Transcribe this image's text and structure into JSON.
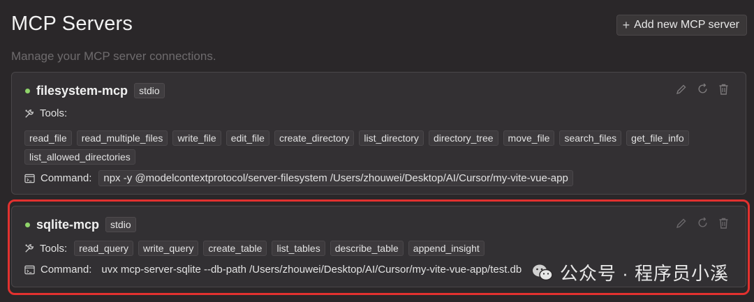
{
  "header": {
    "title": "MCP Servers",
    "subtitle": "Manage your MCP server connections.",
    "add_button": "Add new MCP server"
  },
  "servers": [
    {
      "name": "filesystem-mcp",
      "type": "stdio",
      "status_color": "#8fd46a",
      "tools_label": "Tools:",
      "tools": [
        "read_file",
        "read_multiple_files",
        "write_file",
        "edit_file",
        "create_directory",
        "list_directory",
        "directory_tree",
        "move_file",
        "search_files",
        "get_file_info",
        "list_allowed_directories"
      ],
      "command_label": "Command:",
      "command": "npx -y @modelcontextprotocol/server-filesystem /Users/zhouwei/Desktop/AI/Cursor/my-vite-vue-app"
    },
    {
      "name": "sqlite-mcp",
      "type": "stdio",
      "status_color": "#8fd46a",
      "tools_label": "Tools:",
      "tools": [
        "read_query",
        "write_query",
        "create_table",
        "list_tables",
        "describe_table",
        "append_insight"
      ],
      "command_label": "Command:",
      "command": "uvx mcp-server-sqlite --db-path /Users/zhouwei/Desktop/AI/Cursor/my-vite-vue-app/test.db"
    }
  ],
  "watermark": {
    "text": "公众号 · 程序员小溪"
  },
  "colors": {
    "background": "#2a2729",
    "card": "#333033",
    "highlight": "#e2312f",
    "status_active": "#8fd46a"
  }
}
